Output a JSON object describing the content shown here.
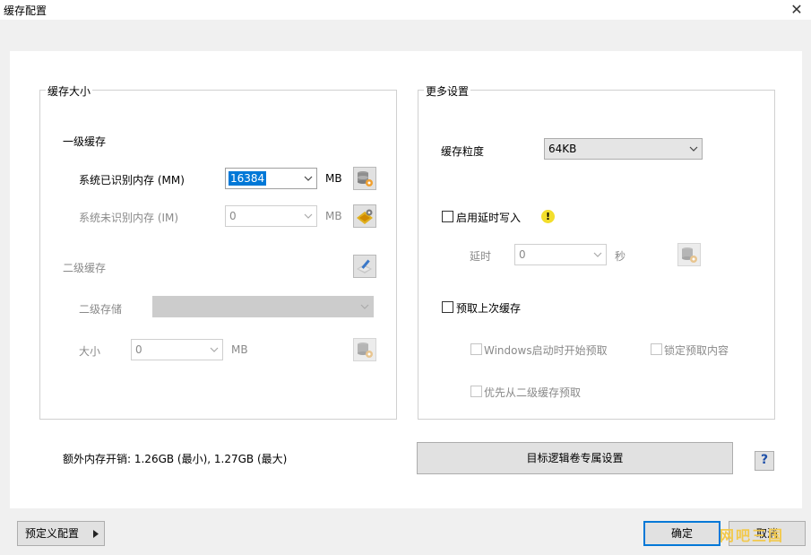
{
  "window": {
    "title": "缓存配置",
    "close_glyph": "✕"
  },
  "cache_size": {
    "group_title": "缓存大小",
    "l1_label": "一级缓存",
    "recognized_label": "系统已识别内存 (MM)",
    "recognized_value": "16384",
    "recognized_unit": "MB",
    "unrecognized_label": "系统未识别内存 (IM)",
    "unrecognized_value": "0",
    "unrecognized_unit": "MB",
    "l2_label": "二级缓存",
    "l2_storage_label": "二级存储",
    "size_label": "大小",
    "size_value": "0",
    "size_unit": "MB"
  },
  "more_settings": {
    "group_title": "更多设置",
    "granularity_label": "缓存粒度",
    "granularity_value": "64KB",
    "deferred_write_label": "启用延时写入",
    "delay_label": "延时",
    "delay_value": "0",
    "delay_unit": "秒",
    "prefetch_label": "预取上次缓存",
    "windows_start_prefetch_label": "Windows启动时开始预取",
    "lock_prefetch_label": "锁定预取内容",
    "prefer_l2_prefetch_label": "优先从二级缓存预取"
  },
  "overhead_text": "额外内存开销: 1.26GB (最小), 1.27GB (最大)",
  "target_volume_button": "目标逻辑卷专属设置",
  "help_glyph": "?",
  "footer": {
    "preset_button": "预定义配置",
    "ok_button": "确定",
    "cancel_button": "取消"
  },
  "watermark_text": "网吧三国",
  "colors": {
    "accent": "#0078d7",
    "warning": "#f3de2c"
  }
}
